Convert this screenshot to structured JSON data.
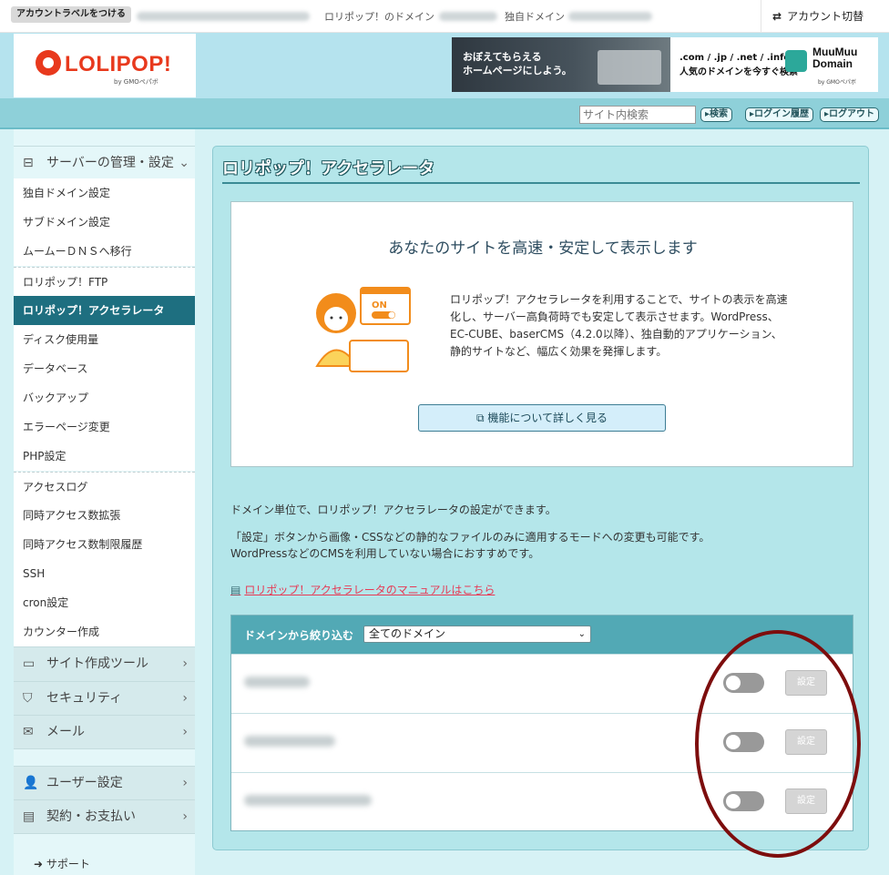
{
  "topbar": {
    "label_button": "アカウントラベルをつける",
    "domain_label": "ロリポップ！のドメイン",
    "custom_domain_label": "独自ドメイン",
    "account_switch": "アカウント切替",
    "switch_icon": "⇄"
  },
  "header": {
    "logo": "LOLIPOP!",
    "logo_sub": "by GMOペパボ",
    "banner_left": "おぼえてもらえる\nホームページにしよう。",
    "banner_tlds": ".com / .jp / .net / .info",
    "banner_tagline": "人気のドメインを今すぐ検索",
    "banner_brand_1": "MuuMuu",
    "banner_brand_2": "Domain",
    "banner_brand_sub": "by GMOペパボ"
  },
  "toolbar": {
    "search_placeholder": "サイト内検索",
    "search_button": "▸検索",
    "history_button": "▸ログイン履歴",
    "logout_button": "▸ログアウト"
  },
  "sidebar": {
    "server_group": "サーバーの管理・設定",
    "items": [
      "独自ドメイン設定",
      "サブドメイン設定",
      "ムームーＤＮＳへ移行",
      "ロリポップ！FTP",
      "ロリポップ！アクセラレータ",
      "ディスク使用量",
      "データベース",
      "バックアップ",
      "エラーページ変更",
      "PHP設定",
      "アクセスログ",
      "同時アクセス数拡張",
      "同時アクセス数制限履歴",
      "SSH",
      "cron設定",
      "カウンター作成"
    ],
    "groups": [
      "サイト作成ツール",
      "セキュリティ",
      "メール",
      "ユーザー設定",
      "契約・お支払い"
    ],
    "support": "サポート"
  },
  "main": {
    "title": "ロリポップ！アクセラレータ",
    "promo_heading": "あなたのサイトを高速・安定して表示します",
    "promo_body": "ロリポップ！アクセラレータを利用することで、サイトの表示を高速化し、サーバー高負荷時でも安定して表示させます。WordPress、EC-CUBE、baserCMS（4.2.0以降）、独自動的アプリケーション、静的サイトなど、幅広く効果を発揮します。",
    "illus_on": "ON",
    "promo_button": "機能について詳しく見る",
    "desc1": "ドメイン単位で、ロリポップ！アクセラレータの設定ができます。",
    "desc2": "「設定」ボタンから画像・CSSなどの静的なファイルのみに適用するモードへの変更も可能です。",
    "desc3": "WordPressなどのCMSを利用していない場合におすすめです。",
    "manual_link": "ロリポップ！アクセラレータのマニュアルはこちら",
    "filter_label": "ドメインから絞り込む",
    "filter_value": "全てのドメイン",
    "set_label": "設定"
  },
  "colors": {
    "accent": "#1e6f80",
    "logo_red": "#e8391d",
    "link_red": "#e63a55",
    "annotation_circle": "#7d0d0d"
  }
}
